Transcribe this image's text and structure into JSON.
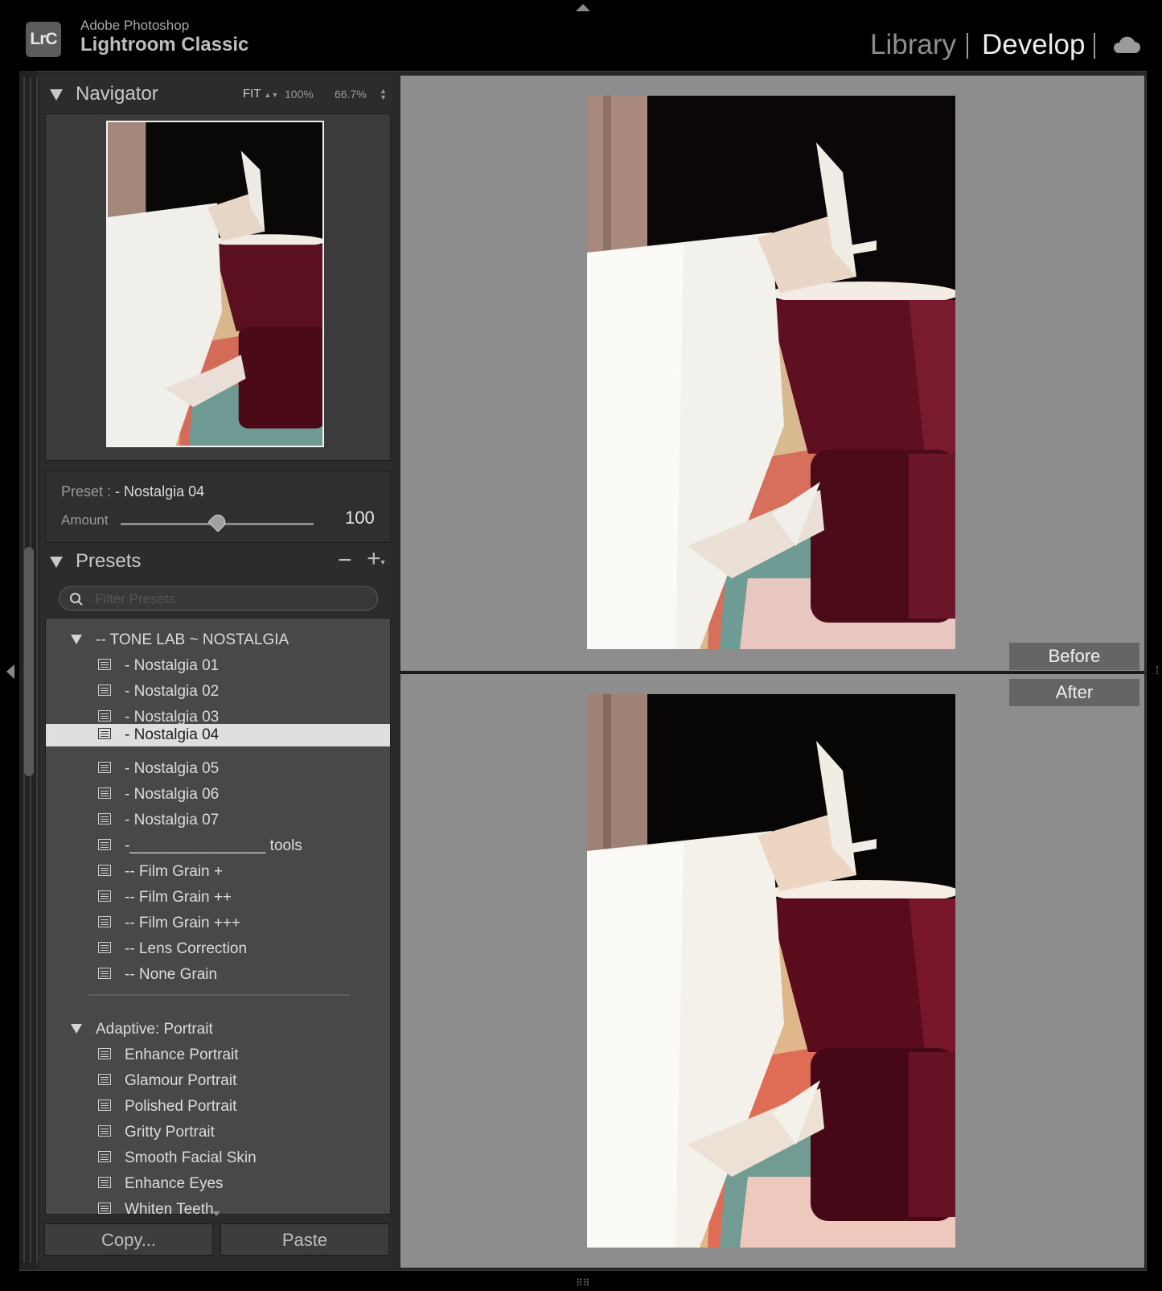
{
  "app": {
    "logo": "LrC",
    "subtitle": "Adobe Photoshop",
    "title": "Lightroom Classic"
  },
  "modules": {
    "library": "Library",
    "develop": "Develop",
    "active": "Develop",
    "cloud_icon": "cloud-icon"
  },
  "navigator": {
    "title": "Navigator",
    "zoom_fit": "FIT",
    "zoom_100": "100%",
    "zoom_custom": "66.7%"
  },
  "preset_amount": {
    "preset_label": "Preset :",
    "preset_name": "- Nostalgia 04",
    "amount_label": "Amount",
    "amount_value": "100",
    "amount_fraction": 0.5
  },
  "presets": {
    "title": "Presets",
    "remove_label": "−",
    "add_label": "+",
    "filter_placeholder": "Filter Presets",
    "groups": [
      {
        "name": "-- TONE LAB ~ NOSTALGIA",
        "items": [
          "- Nostalgia 01",
          "- Nostalgia 02",
          "- Nostalgia 03",
          "- Nostalgia 04",
          "- Nostalgia 05",
          "- Nostalgia 06",
          "- Nostalgia 07",
          "-________________ tools",
          "-- Film Grain +",
          "-- Film Grain ++",
          "-- Film Grain +++",
          "-- Lens Correction",
          "-- None Grain"
        ],
        "selected_index": 3
      },
      {
        "name": "Adaptive: Portrait",
        "items": [
          "Enhance Portrait",
          "Glamour Portrait",
          "Polished Portrait",
          "Gritty Portrait",
          "Smooth Facial Skin",
          "Enhance Eyes",
          "Whiten Teeth"
        ]
      }
    ]
  },
  "buttons": {
    "copy": "Copy...",
    "paste": "Paste"
  },
  "compare": {
    "before": "Before",
    "after": "After"
  }
}
